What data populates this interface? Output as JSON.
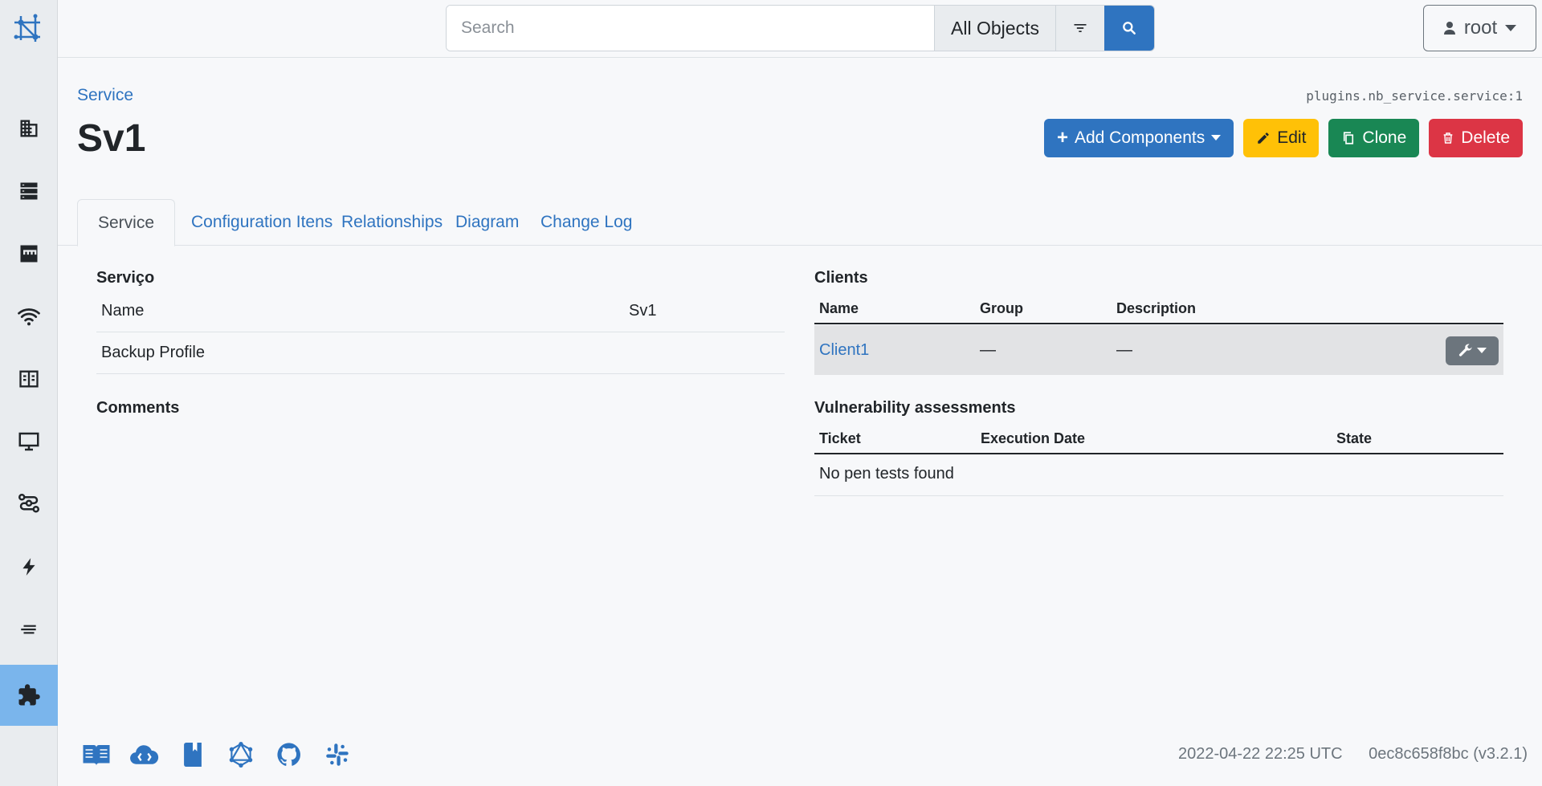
{
  "search": {
    "placeholder": "Search",
    "scope": "All Objects"
  },
  "user": {
    "name": "root"
  },
  "breadcrumb": "Service",
  "object_id": "plugins.nb_service.service:1",
  "title": "Sv1",
  "actions": {
    "add_components": "Add Components",
    "edit": "Edit",
    "clone": "Clone",
    "delete": "Delete"
  },
  "tabs": [
    "Service",
    "Configuration Itens",
    "Relationships",
    "Diagram",
    "Change Log"
  ],
  "service_panel": {
    "title": "Serviço",
    "rows": [
      {
        "key": "Name",
        "value": "Sv1"
      },
      {
        "key": "Backup Profile",
        "value": ""
      }
    ]
  },
  "comments": {
    "title": "Comments"
  },
  "clients": {
    "title": "Clients",
    "headers": [
      "Name",
      "Group",
      "Description"
    ],
    "rows": [
      {
        "name": "Client1",
        "group": "—",
        "description": "—"
      }
    ]
  },
  "vulnerability": {
    "title": "Vulnerability assessments",
    "headers": [
      "Ticket",
      "Execution Date",
      "State"
    ],
    "empty": "No pen tests found"
  },
  "footer": {
    "timestamp": "2022-04-22 22:25 UTC",
    "version": "0ec8c658f8bc (v3.2.1)"
  },
  "colors": {
    "primary": "#2f74c0",
    "warning": "#ffc107",
    "success": "#198754",
    "danger": "#dc3545",
    "active_nav": "#7ab5ec"
  },
  "icons": {
    "sidebar": [
      "organization-icon",
      "devices-icon",
      "ipam-icon",
      "wireless-icon",
      "circuits-icon",
      "virtualization-icon",
      "connections-icon",
      "power-icon",
      "other-icon",
      "plugins-icon"
    ],
    "footer": [
      "docs-icon",
      "api-icon",
      "api-docs-icon",
      "graphql-icon",
      "github-icon",
      "slack-icon"
    ]
  }
}
